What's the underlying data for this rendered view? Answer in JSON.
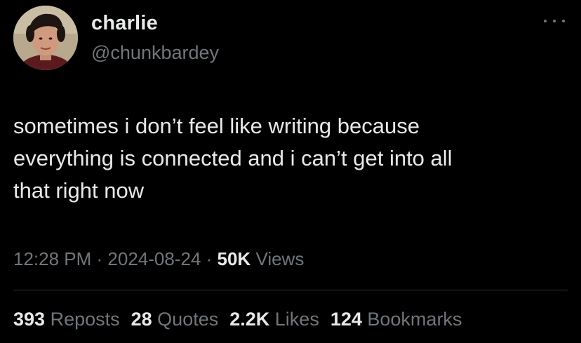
{
  "author": {
    "display_name": "charlie",
    "handle": "@chunkbardey"
  },
  "more_icon": "more-horizontal-icon",
  "tweet": {
    "text": "sometimes i don’t feel like writing because\neverything is connected and i can’t get into all\nthat right now"
  },
  "meta": {
    "time": "12:28 PM",
    "separator": " · ",
    "date": "2024-08-24",
    "views_count": "50K",
    "views_label": " Views"
  },
  "stats": {
    "reposts": {
      "count": "393",
      "label": " Reposts"
    },
    "quotes": {
      "count": "28",
      "label": " Quotes"
    },
    "likes": {
      "count": "2.2K",
      "label": " Likes"
    },
    "bookmarks": {
      "count": "124",
      "label": " Bookmarks"
    }
  },
  "colors": {
    "background": "#000000",
    "primary_text": "#e7e9ea",
    "secondary_text": "#71767b",
    "divider": "#2f3336"
  }
}
